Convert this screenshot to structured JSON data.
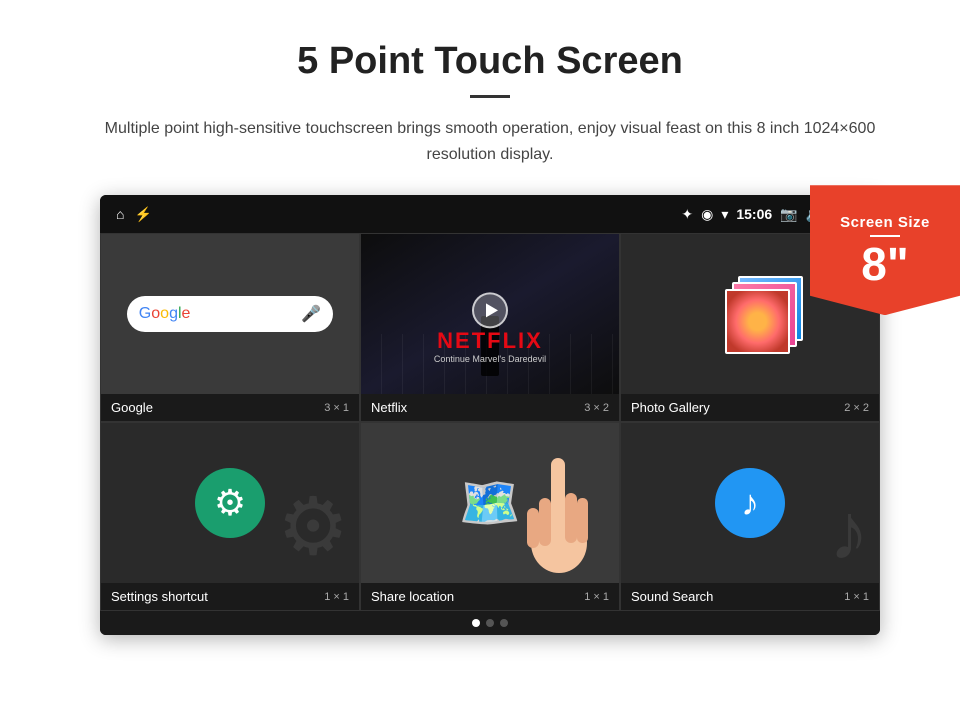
{
  "page": {
    "title": "5 Point Touch Screen",
    "subtitle": "Multiple point high-sensitive touchscreen brings smooth operation, enjoy visual feast on this 8 inch 1024×600 resolution display.",
    "badge": {
      "line1": "Screen Size",
      "line2": "8\""
    }
  },
  "status_bar": {
    "time": "15:06"
  },
  "apps": {
    "row1": [
      {
        "name": "Google",
        "size": "3 × 1",
        "type": "google"
      },
      {
        "name": "Netflix",
        "size": "3 × 2",
        "type": "netflix",
        "netflix_logo": "NETFLIX",
        "netflix_sub": "Continue Marvel's Daredevil"
      },
      {
        "name": "Photo Gallery",
        "size": "2 × 2",
        "type": "gallery"
      }
    ],
    "row2": [
      {
        "name": "Settings shortcut",
        "size": "1 × 1",
        "type": "settings"
      },
      {
        "name": "Share location",
        "size": "1 × 1",
        "type": "share"
      },
      {
        "name": "Sound Search",
        "size": "1 × 1",
        "type": "sound"
      }
    ]
  }
}
